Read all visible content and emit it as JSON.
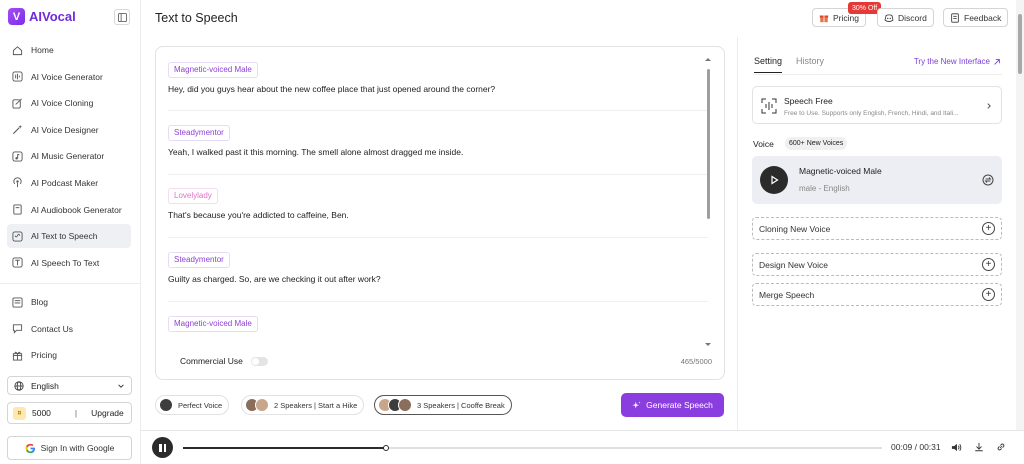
{
  "app": {
    "logo_letter": "V",
    "logo_text": "AIVocal",
    "page_title": "Text to Speech"
  },
  "sidebar": {
    "nav": [
      {
        "label": "Home",
        "icon": "home-icon",
        "active": false
      },
      {
        "label": "AI Voice Generator",
        "icon": "voice-generator-icon",
        "active": false
      },
      {
        "label": "AI Voice Cloning",
        "icon": "voice-cloning-icon",
        "active": false
      },
      {
        "label": "AI Voice Designer",
        "icon": "magic-wand-icon",
        "active": false
      },
      {
        "label": "AI Music Generator",
        "icon": "music-note-icon",
        "active": false
      },
      {
        "label": "AI Podcast Maker",
        "icon": "podcast-icon",
        "active": false
      },
      {
        "label": "AI Audiobook Generator",
        "icon": "book-icon",
        "active": false
      },
      {
        "label": "AI Text to Speech",
        "icon": "text-speech-icon",
        "active": true
      },
      {
        "label": "AI Speech To Text",
        "icon": "speech-text-icon",
        "active": false
      }
    ],
    "secondary": [
      {
        "label": "Blog",
        "icon": "blog-icon"
      },
      {
        "label": "Contact Us",
        "icon": "contact-icon"
      },
      {
        "label": "Pricing",
        "icon": "gift-icon"
      }
    ],
    "language": "English",
    "credits": "5000",
    "separator": "|",
    "upgrade_label": "Upgrade",
    "signin_label": "Sign In with Google"
  },
  "header": {
    "pricing_label": "Pricing",
    "sale_badge": "30% Off",
    "discord_label": "Discord",
    "feedback_label": "Feedback"
  },
  "editor": {
    "lines": [
      {
        "speaker": "Magnetic-voiced Male",
        "color": "#8e3fd6",
        "text": "Hey, did you guys hear about the new coffee place that just opened around the corner?"
      },
      {
        "speaker": "Steadymentor",
        "color": "#8e3fd6",
        "text": "Yeah, I walked past it this morning. The smell alone almost dragged me inside."
      },
      {
        "speaker": "Lovelylady",
        "color": "#e070c8",
        "text": "That's because you're addicted to caffeine, Ben."
      },
      {
        "speaker": "Steadymentor",
        "color": "#8e3fd6",
        "text": "Guilty as charged. So, are we checking it out after work?"
      },
      {
        "speaker": "Magnetic-voiced Male",
        "color": "#8e3fd6",
        "text": ""
      }
    ],
    "commercial_label": "Commercial Use",
    "char_count": "465/5000"
  },
  "presets": [
    {
      "label": "Perfect Voice",
      "selected": false
    },
    {
      "label": "2 Speakers | Start a Hike",
      "selected": false
    },
    {
      "label": "3 Speakers | Cooffe Break",
      "selected": true
    }
  ],
  "generate_label": "Generate Speech",
  "settings": {
    "tab_setting": "Setting",
    "tab_history": "History",
    "try_new": "Try the New Interface",
    "speech_title": "Speech Free",
    "speech_sub": "Free to Use. Supports only English, French, Hindi, and Itali...",
    "voice_label": "Voice",
    "voice_badge": "600+ New Voices",
    "voice_name": "Magnetic-voiced Male",
    "voice_meta": "male - English",
    "clone_label": "Cloning New Voice",
    "design_label": "Design New Voice",
    "merge_label": "Merge Speech"
  },
  "player": {
    "time": "00:09 / 00:31",
    "progress_fraction": 0.29
  },
  "colors": {
    "accent": "#8b3ee0",
    "sale": "#e53935"
  }
}
